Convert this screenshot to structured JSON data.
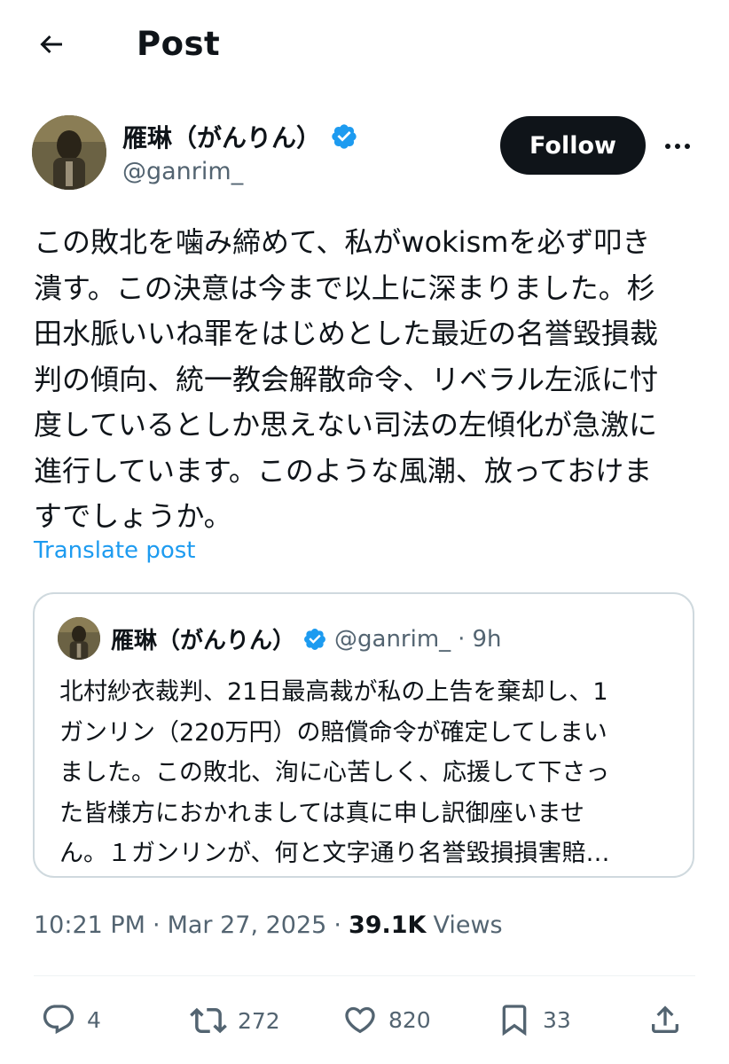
{
  "header": {
    "title": "Post"
  },
  "author": {
    "name": "雁琳（がんりん）",
    "handle": "@ganrim_",
    "verified": true,
    "follow_label": "Follow"
  },
  "post": {
    "lines": [
      "この敗北を噛み締めて、私がwokismを必ず叩き",
      "潰す。この決意は今まで以上に深まりました。杉",
      "田水脈いいね罪をはじめとした最近の名誉毀損裁",
      "判の傾向、統一教会解散命令、リベラル左派に忖",
      "度しているとしか思えない司法の左傾化が急激に",
      "進行しています。このような風潮、放っておけま",
      "すでしょうか。"
    ],
    "translate_label": "Translate post"
  },
  "quote": {
    "name": "雁琳（がんりん）",
    "handle": "@ganrim_",
    "separator": "·",
    "time": "9h",
    "lines": [
      "北村紗衣裁判、21日最高裁が私の上告を棄却し、1",
      "ガンリン（220万円）の賠償命令が確定してしまい",
      "ました。この敗北、洵に心苦しく、応援して下さっ",
      "た皆様方におかれましては真に申し訳御座いませ",
      "ん。１ガンリンが、何と文字通り名誉毀損損害賠…"
    ]
  },
  "meta": {
    "time": "10:21 PM",
    "separator": "·",
    "date": "Mar 27, 2025",
    "views_count": "39.1K",
    "views_label": "Views"
  },
  "actions": {
    "replies": "4",
    "reposts": "272",
    "likes": "820",
    "bookmarks": "33"
  },
  "colors": {
    "accent": "#1d9bf0",
    "text": "#0f1419",
    "secondary": "#536471",
    "border": "#cfd9de"
  },
  "icons": [
    "back-arrow-icon",
    "verified-badge-icon",
    "more-icon",
    "reply-icon",
    "repost-icon",
    "like-icon",
    "bookmark-icon",
    "share-icon"
  ]
}
